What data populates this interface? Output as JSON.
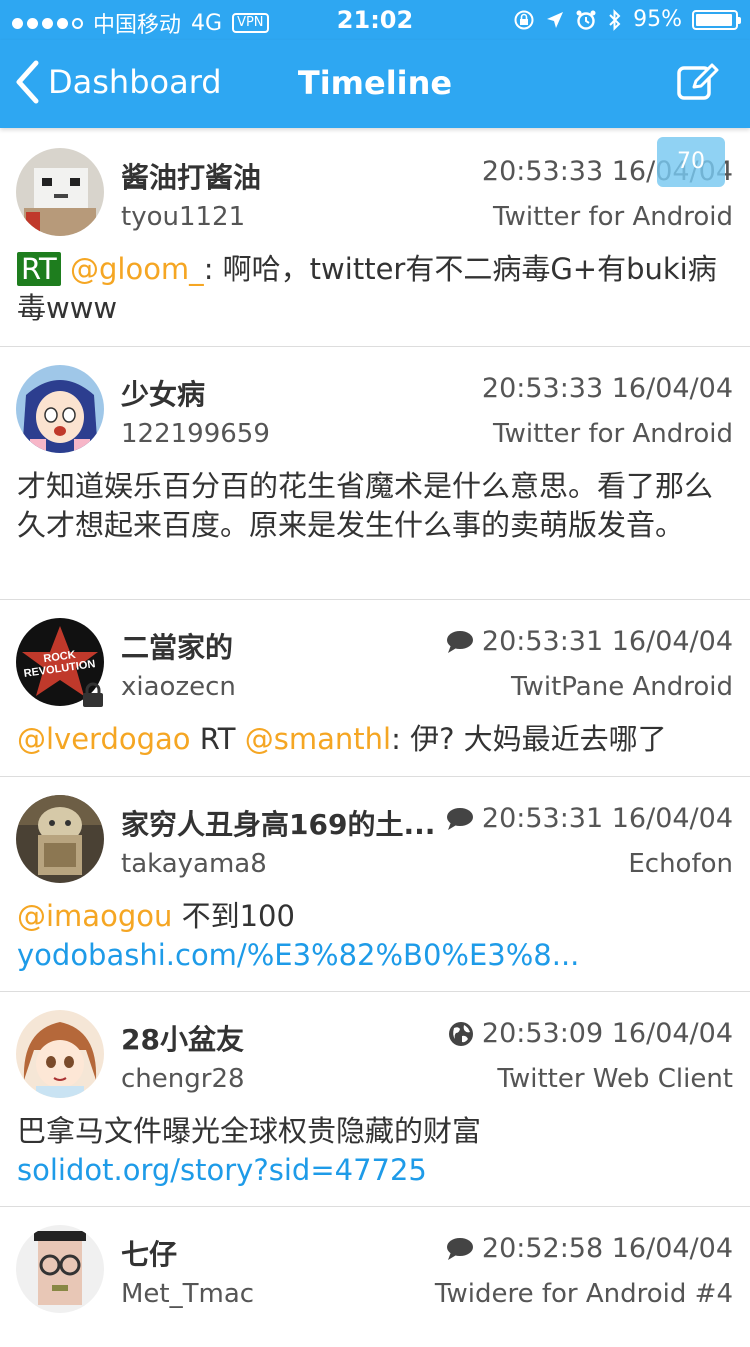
{
  "status_bar": {
    "carrier": "中国移动",
    "network": "4G",
    "vpn": "VPN",
    "time": "21:02",
    "battery_percent": "95%",
    "battery_level": 0.95
  },
  "nav": {
    "back_label": "Dashboard",
    "title": "Timeline"
  },
  "unread_badge": "70",
  "colors": {
    "accent": "#2ea7f2",
    "mention": "#f5a623",
    "link": "#1e9be8",
    "rt_badge": "#1e7d1e"
  },
  "tweets": [
    {
      "name": "酱油打酱油",
      "handle": "tyou1121",
      "time": "20:53:33 16/04/04",
      "source": "Twitter for Android",
      "icon": "",
      "segments": [
        {
          "type": "rt",
          "text": "RT"
        },
        {
          "type": "text",
          "text": " "
        },
        {
          "type": "mention",
          "text": "@gloom_"
        },
        {
          "type": "text",
          "text": ": 啊哈，twitter有不二病毒G+有buki病毒www"
        }
      ]
    },
    {
      "name": "少女病",
      "handle": "122199659",
      "time": "20:53:33 16/04/04",
      "source": "Twitter for Android",
      "icon": "",
      "segments": [
        {
          "type": "text",
          "text": "才知道娱乐百分百的花生省魔术是什么意思。看了那么久才想起来百度。原来是发生什么事的卖萌版发音。"
        }
      ]
    },
    {
      "name": "二當家的",
      "handle": "xiaozecn",
      "time": "20:53:31 16/04/04",
      "source": "TwitPane Android",
      "icon": "reply-bubble-icon",
      "locked": true,
      "avatar_text": [
        "ROCK",
        "REVOLUTION"
      ],
      "segments": [
        {
          "type": "mention",
          "text": "@lverdogao"
        },
        {
          "type": "text",
          "text": "  RT "
        },
        {
          "type": "mention",
          "text": "@smanthl"
        },
        {
          "type": "text",
          "text": ": 伊? 大妈最近去哪了"
        }
      ]
    },
    {
      "name": "家穷人丑身高169的土...",
      "handle": "takayama8",
      "time": "20:53:31 16/04/04",
      "source": "Echofon",
      "icon": "reply-bubble-icon",
      "segments": [
        {
          "type": "mention",
          "text": "@imaogou"
        },
        {
          "type": "text",
          "text": " 不到100 "
        },
        {
          "type": "link",
          "text": "yodobashi.com/%E3%82%B0%E3%8..."
        }
      ]
    },
    {
      "name": "28小盆友",
      "handle": "chengr28",
      "time": "20:53:09 16/04/04",
      "source": "Twitter Web Client",
      "icon": "globe-icon",
      "segments": [
        {
          "type": "text",
          "text": "巴拿马文件曝光全球权贵隐藏的财富 "
        },
        {
          "type": "link",
          "text": "solidot.org/story?sid=47725"
        }
      ]
    },
    {
      "name": "七仔",
      "handle": "Met_Tmac",
      "time": "20:52:58 16/04/04",
      "source": "Twidere for Android #4",
      "icon": "reply-bubble-icon",
      "segments": []
    }
  ]
}
